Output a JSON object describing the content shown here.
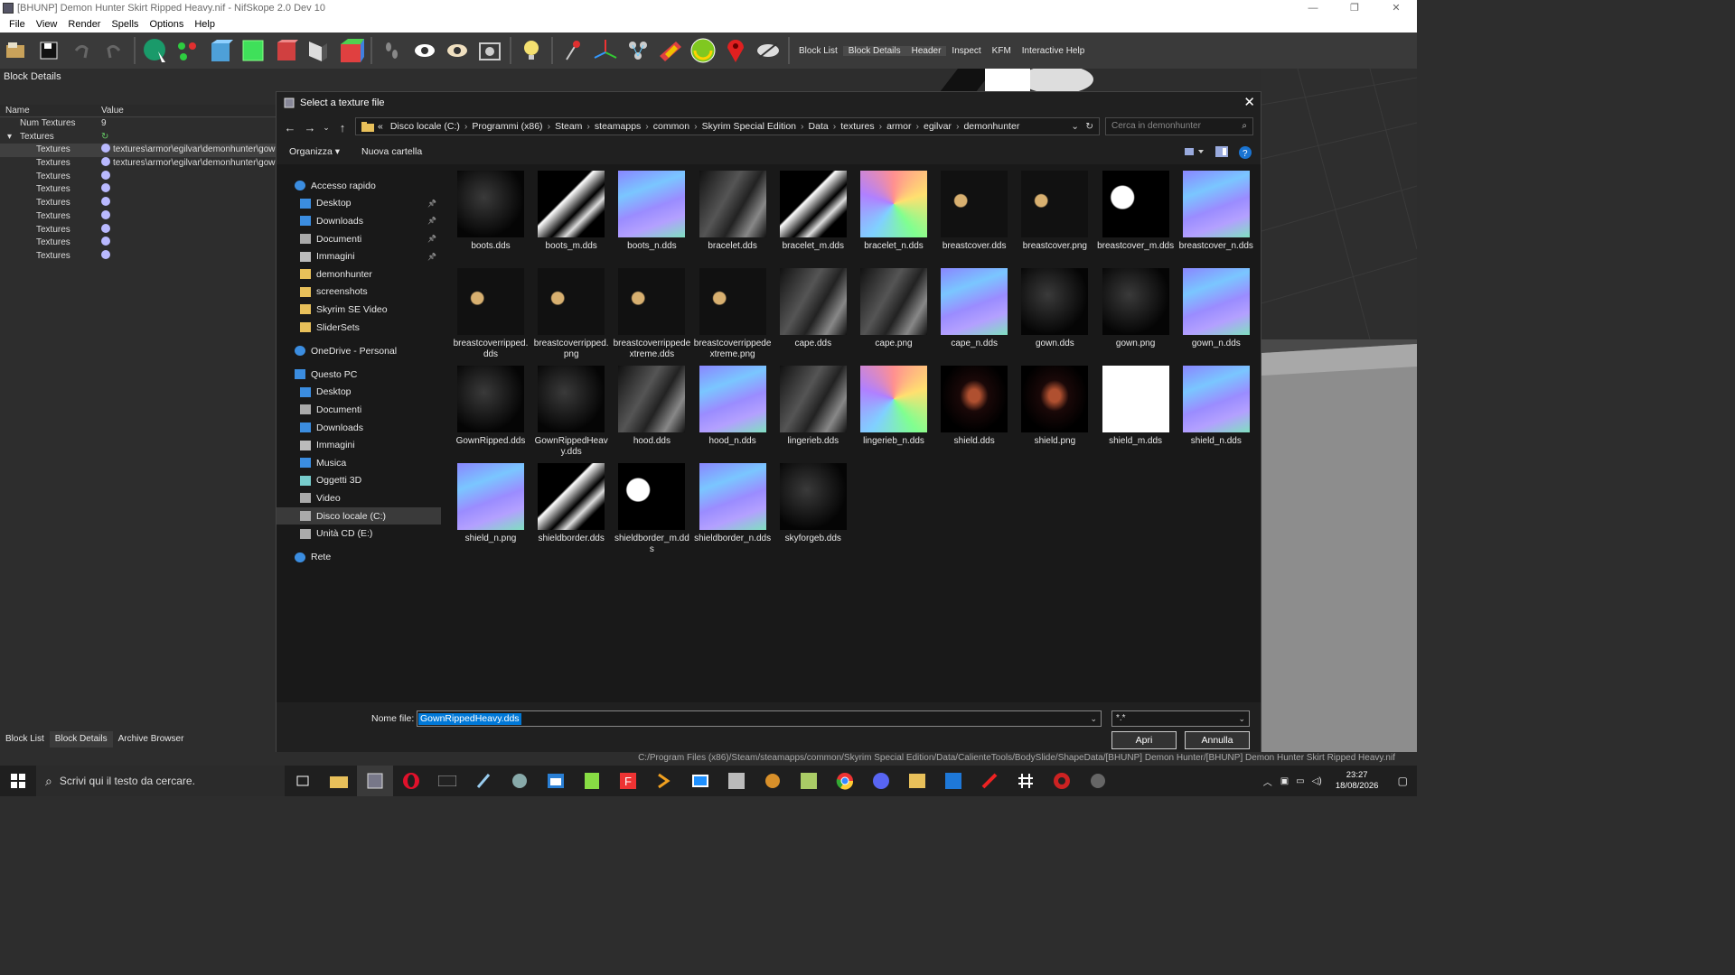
{
  "window": {
    "title": "[BHUNP] Demon Hunter Skirt Ripped Heavy.nif - NifSkope 2.0 Dev 10",
    "controls": [
      "—",
      "❐",
      "✕"
    ]
  },
  "menu": [
    "File",
    "View",
    "Render",
    "Spells",
    "Options",
    "Help"
  ],
  "toolbar": {
    "links": [
      "Block List",
      "Block Details",
      "Header",
      "Inspect",
      "KFM",
      "Interactive Help"
    ]
  },
  "left_panel": {
    "title": "Block Details",
    "columns": [
      "Name",
      "Value"
    ],
    "rows": [
      {
        "name": "Num Textures",
        "value": "9",
        "indent": 1
      },
      {
        "name": "Textures",
        "value": "",
        "indent": 0,
        "expander": true
      },
      {
        "name": "Textures",
        "value": "textures\\armor\\egilvar\\demonhunter\\gown",
        "indent": 2,
        "selected": true
      },
      {
        "name": "Textures",
        "value": "textures\\armor\\egilvar\\demonhunter\\gown",
        "indent": 2
      },
      {
        "name": "Textures",
        "value": "",
        "indent": 2
      },
      {
        "name": "Textures",
        "value": "",
        "indent": 2
      },
      {
        "name": "Textures",
        "value": "",
        "indent": 2
      },
      {
        "name": "Textures",
        "value": "",
        "indent": 2
      },
      {
        "name": "Textures",
        "value": "",
        "indent": 2
      },
      {
        "name": "Textures",
        "value": "",
        "indent": 2
      },
      {
        "name": "Textures",
        "value": "",
        "indent": 2
      }
    ],
    "bottom_tabs": [
      "Block List",
      "Block Details",
      "Archive Browser"
    ]
  },
  "status_path": "C:/Program Files (x86)/Steam/steamapps/common/Skyrim Special Edition/Data/CalienteTools/BodySlide/ShapeData/[BHUNP] Demon Hunter/[BHUNP] Demon Hunter Skirt Ripped Heavy.nif",
  "dialog": {
    "title": "Select a texture file",
    "address_prefix": "«",
    "address": [
      "Disco locale (C:)",
      "Programmi (x86)",
      "Steam",
      "steamapps",
      "common",
      "Skyrim Special Edition",
      "Data",
      "textures",
      "armor",
      "egilvar",
      "demonhunter"
    ],
    "search_placeholder": "Cerca in demonhunter",
    "commands": [
      "Organizza ▾",
      "Nuova cartella"
    ],
    "nav": [
      {
        "label": "Accesso rapido",
        "level": 0,
        "icon": "star-icon"
      },
      {
        "label": "Desktop",
        "level": 1,
        "icon": "desktop-icon",
        "pinned": true
      },
      {
        "label": "Downloads",
        "level": 1,
        "icon": "download-icon",
        "pinned": true
      },
      {
        "label": "Documenti",
        "level": 1,
        "icon": "document-icon",
        "pinned": true
      },
      {
        "label": "Immagini",
        "level": 1,
        "icon": "image-icon",
        "pinned": true
      },
      {
        "label": "demonhunter",
        "level": 1,
        "icon": "folder-icon"
      },
      {
        "label": "screenshots",
        "level": 1,
        "icon": "folder-icon"
      },
      {
        "label": "Skyrim SE Video",
        "level": 1,
        "icon": "folder-icon"
      },
      {
        "label": "SliderSets",
        "level": 1,
        "icon": "folder-icon"
      },
      {
        "label": "OneDrive - Personal",
        "level": 0,
        "icon": "cloud-icon",
        "gap": true
      },
      {
        "label": "Questo PC",
        "level": 0,
        "icon": "pc-icon",
        "gap": true
      },
      {
        "label": "Desktop",
        "level": 1,
        "icon": "desktop-icon"
      },
      {
        "label": "Documenti",
        "level": 1,
        "icon": "document-icon"
      },
      {
        "label": "Downloads",
        "level": 1,
        "icon": "download-icon"
      },
      {
        "label": "Immagini",
        "level": 1,
        "icon": "image-icon"
      },
      {
        "label": "Musica",
        "level": 1,
        "icon": "music-icon"
      },
      {
        "label": "Oggetti 3D",
        "level": 1,
        "icon": "cube-icon"
      },
      {
        "label": "Video",
        "level": 1,
        "icon": "video-icon"
      },
      {
        "label": "Disco locale (C:)",
        "level": 1,
        "icon": "drive-icon",
        "selected": true
      },
      {
        "label": "Unità CD (E:)",
        "level": 1,
        "icon": "cd-icon"
      },
      {
        "label": "Rete",
        "level": 0,
        "icon": "network-icon",
        "gap": true
      }
    ],
    "files": [
      {
        "name": "boots.dds",
        "thumb": "dark"
      },
      {
        "name": "boots_m.dds",
        "thumb": "mask"
      },
      {
        "name": "boots_n.dds",
        "thumb": "normal"
      },
      {
        "name": "bracelet.dds",
        "thumb": "grey"
      },
      {
        "name": "bracelet_m.dds",
        "thumb": "mask"
      },
      {
        "name": "bracelet_n.dds",
        "thumb": "rainbow"
      },
      {
        "name": "breastcover.dds",
        "thumb": "gold"
      },
      {
        "name": "breastcover.png",
        "thumb": "gold"
      },
      {
        "name": "breastcover_m.dds",
        "thumb": "white"
      },
      {
        "name": "breastcover_n.dds",
        "thumb": "normal"
      },
      {
        "name": "breastcoverripped.dds",
        "thumb": "gold"
      },
      {
        "name": "breastcoverripped.png",
        "thumb": "gold"
      },
      {
        "name": "breastcoverrippedextreme.dds",
        "thumb": "gold"
      },
      {
        "name": "breastcoverrippedextreme.png",
        "thumb": "gold"
      },
      {
        "name": "cape.dds",
        "thumb": "grey"
      },
      {
        "name": "cape.png",
        "thumb": "grey"
      },
      {
        "name": "cape_n.dds",
        "thumb": "normal"
      },
      {
        "name": "gown.dds",
        "thumb": "dark"
      },
      {
        "name": "gown.png",
        "thumb": "dark"
      },
      {
        "name": "gown_n.dds",
        "thumb": "normal"
      },
      {
        "name": "GownRipped.dds",
        "thumb": "dark"
      },
      {
        "name": "GownRippedHeavy.dds",
        "thumb": "dark"
      },
      {
        "name": "hood.dds",
        "thumb": "grey"
      },
      {
        "name": "hood_n.dds",
        "thumb": "normal"
      },
      {
        "name": "lingerieb.dds",
        "thumb": "grey"
      },
      {
        "name": "lingerieb_n.dds",
        "thumb": "rainbow"
      },
      {
        "name": "shield.dds",
        "thumb": "figure"
      },
      {
        "name": "shield.png",
        "thumb": "figure"
      },
      {
        "name": "shield_m.dds",
        "thumb": "blank"
      },
      {
        "name": "shield_n.dds",
        "thumb": "normal"
      },
      {
        "name": "shield_n.png",
        "thumb": "normal"
      },
      {
        "name": "shieldborder.dds",
        "thumb": "mask"
      },
      {
        "name": "shieldborder_m.dds",
        "thumb": "white"
      },
      {
        "name": "shieldborder_n.dds",
        "thumb": "normal"
      },
      {
        "name": "skyforgeb.dds",
        "thumb": "dark"
      }
    ],
    "filename_label": "Nome file:",
    "filename_value": "GownRippedHeavy.dds",
    "filetype_value": "*.*",
    "open_label": "Apri",
    "cancel_label": "Annulla"
  },
  "taskbar": {
    "search_placeholder": "Scrivi qui il testo da cercare.",
    "time": "23:27",
    "date": "18/08/2026"
  },
  "colors": {
    "dialog_bg": "#191919",
    "selection": "#0078d7",
    "normal_map": "#8a86ff",
    "gold": "#c8a060"
  }
}
